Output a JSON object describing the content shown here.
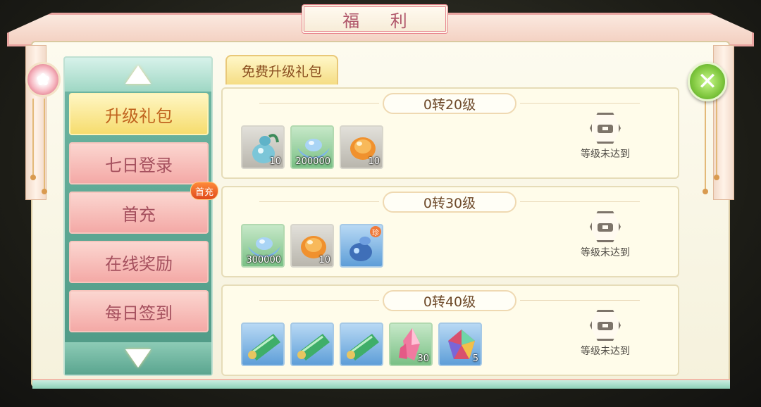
{
  "window": {
    "title": "福 利"
  },
  "tab": {
    "label": "免费升级礼包"
  },
  "sidebar": {
    "items": [
      {
        "label": "升级礼包",
        "active": true
      },
      {
        "label": "七日登录",
        "active": false
      },
      {
        "label": "首充",
        "active": false,
        "badge": "首充"
      },
      {
        "label": "在线奖励",
        "active": false
      },
      {
        "label": "每日签到",
        "active": false
      }
    ]
  },
  "rewards": [
    {
      "level": "0转20级",
      "status": "等级未达到",
      "items": [
        {
          "icon": "gourd-potion-icon",
          "qty": "10",
          "bg": "grey"
        },
        {
          "icon": "silver-ingot-icon",
          "qty": "200000",
          "bg": "green"
        },
        {
          "icon": "orange-gem-icon",
          "qty": "10",
          "bg": "grey"
        }
      ]
    },
    {
      "level": "0转30级",
      "status": "等级未达到",
      "items": [
        {
          "icon": "silver-ingot-icon",
          "qty": "300000",
          "bg": "green"
        },
        {
          "icon": "orange-gem-icon",
          "qty": "10",
          "bg": "grey"
        },
        {
          "icon": "blue-flask-icon",
          "qty": "",
          "bg": "blue",
          "rare": "珍"
        }
      ]
    },
    {
      "level": "0转40级",
      "status": "等级未达到",
      "items": [
        {
          "icon": "jade-scroll-icon",
          "qty": "",
          "bg": "blue"
        },
        {
          "icon": "jade-scroll-icon",
          "qty": "",
          "bg": "blue"
        },
        {
          "icon": "jade-scroll-icon",
          "qty": "",
          "bg": "blue"
        },
        {
          "icon": "pink-crystal-icon",
          "qty": "30",
          "bg": "green"
        },
        {
          "icon": "rainbow-gem-icon",
          "qty": "5",
          "bg": "blue"
        }
      ]
    }
  ],
  "colors": {
    "accent": "#e7868f",
    "sidebar": "#5aa58f",
    "active": "#f6dc6e",
    "close": "#7ec63d"
  }
}
